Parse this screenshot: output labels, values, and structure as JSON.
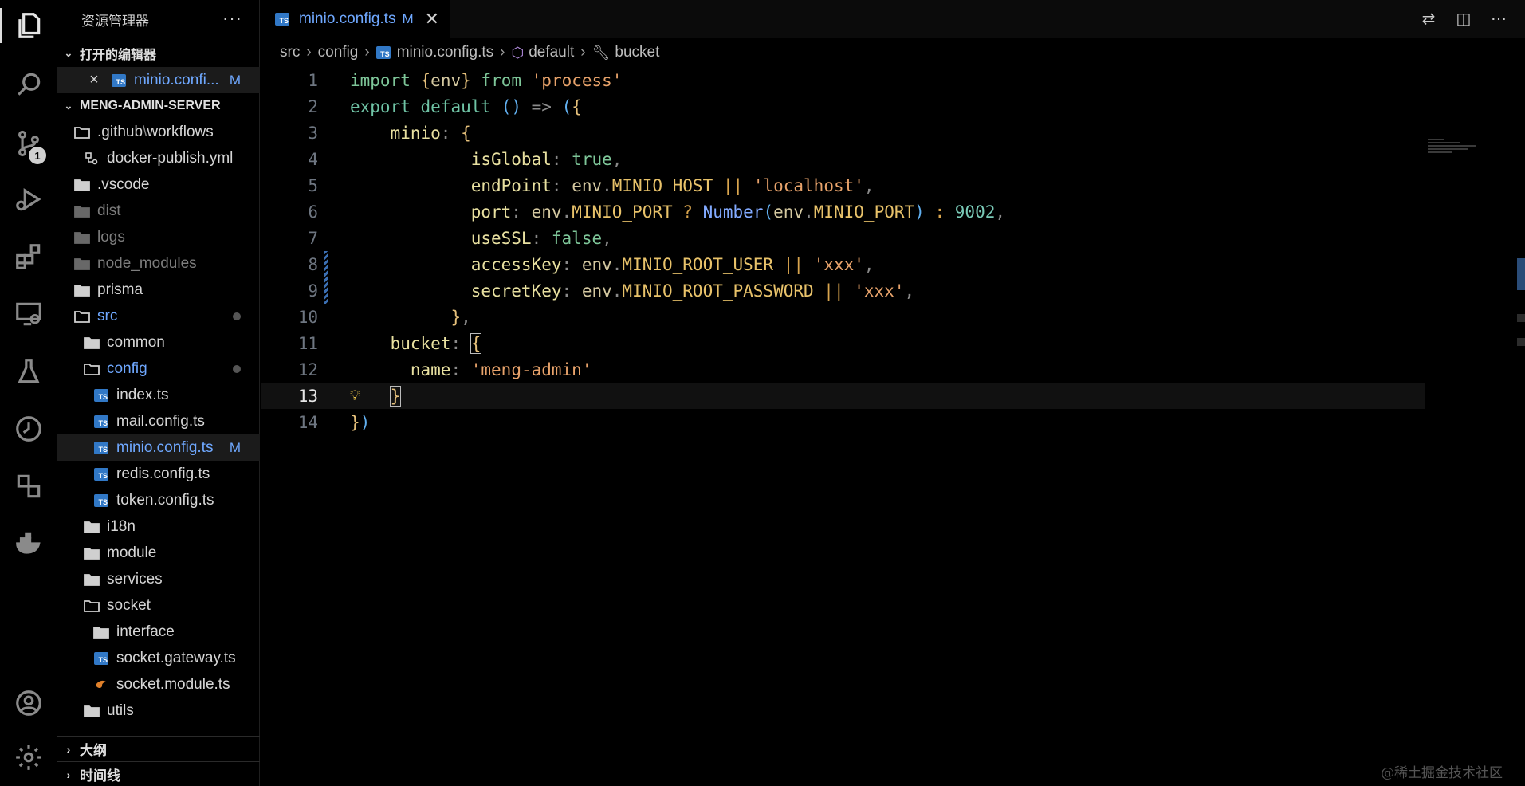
{
  "activity_bar": {
    "items": [
      "explorer-icon",
      "search-icon",
      "source-control-icon",
      "run-debug-icon",
      "extensions-icon",
      "remote-explorer-icon",
      "testing-icon",
      "timeline-icon",
      "containers-icon",
      "docker-icon"
    ],
    "source_control_badge": "1",
    "bottom_items": [
      "account-icon",
      "settings-gear-icon"
    ]
  },
  "sidebar": {
    "title": "资源管理器",
    "more": "···",
    "open_editors": {
      "title": "打开的编辑器",
      "items": [
        {
          "name": "minio.confi...",
          "status": "M"
        }
      ]
    },
    "project": {
      "title": "MENG-ADMIN-SERVER",
      "tree": [
        {
          "label": ".github",
          "sep": "\\",
          "label2": "workflows"
        },
        {
          "label": "docker-publish.yml"
        },
        {
          "label": ".vscode"
        },
        {
          "label": "dist"
        },
        {
          "label": "logs"
        },
        {
          "label": "node_modules"
        },
        {
          "label": "prisma"
        },
        {
          "label": "src"
        },
        {
          "label": "common"
        },
        {
          "label": "config"
        },
        {
          "label": "index.ts"
        },
        {
          "label": "mail.config.ts"
        },
        {
          "label": "minio.config.ts",
          "status": "M"
        },
        {
          "label": "redis.config.ts"
        },
        {
          "label": "token.config.ts"
        },
        {
          "label": "i18n"
        },
        {
          "label": "module"
        },
        {
          "label": "services"
        },
        {
          "label": "socket"
        },
        {
          "label": "interface"
        },
        {
          "label": "socket.gateway.ts"
        },
        {
          "label": "socket.module.ts"
        },
        {
          "label": "utils"
        }
      ]
    },
    "outline_title": "大纲",
    "timeline_title": "时间线"
  },
  "tab": {
    "name": "minio.config.ts",
    "status": "M",
    "close": "✕"
  },
  "breadcrumb": {
    "items": [
      "src",
      "config",
      "minio.config.ts",
      "default",
      "bucket"
    ]
  },
  "editor": {
    "line_numbers": [
      "1",
      "2",
      "3",
      "4",
      "5",
      "6",
      "7",
      "8",
      "9",
      "10",
      "11",
      "12",
      "13",
      "14"
    ],
    "current_line": "13"
  },
  "watermark": "@稀土掘金技术社区"
}
